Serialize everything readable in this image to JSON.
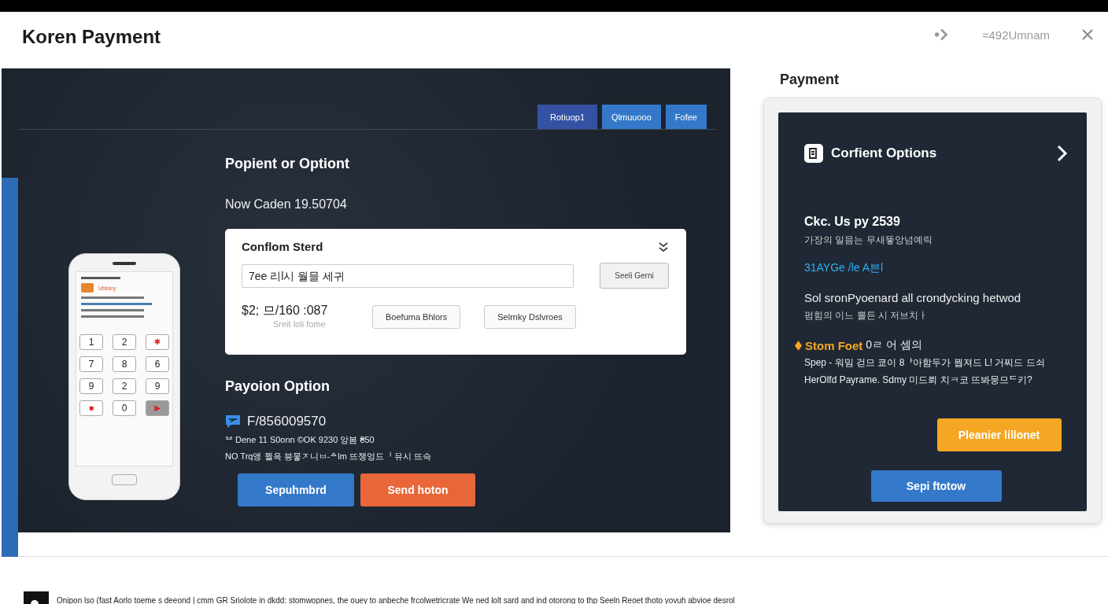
{
  "header": {
    "title": "Koren Payment",
    "account": "≈492Umnam"
  },
  "main": {
    "tabs": [
      {
        "label": "Rotiuop1",
        "selected": true
      },
      {
        "label": "Qlmuuooo",
        "selected": false
      },
      {
        "label": "Fofee",
        "selected": false
      }
    ],
    "heading": "Popient or Optiont",
    "subline": "Now Caden 19.50704",
    "confirm_card": {
      "title": "Conflom Sterd",
      "input_value": "7ee 리l시 월믈 세귀",
      "input_button": "Seeli Gerni",
      "amount": "$2; 므/160 :087",
      "amount_note": "Sreit loli fome",
      "buttons": [
        "Boefuma Bhlors",
        "Selrnky Dslvroes"
      ]
    },
    "payment_heading": "Payoion Option",
    "account_number": "F/856009570",
    "notes": [
      "ᄇ Dene 11 S0onn ©OK 9230 앙봄 ₴50",
      "NO Trq앵 뭘윽 븡뭏ᅎ니ㅂ-ᅀlm 뜨쟁엉드ᅵ 뮤시 뜨슥"
    ],
    "actions": [
      {
        "label": "Sepuhmbrd",
        "kind": "primary"
      },
      {
        "label": "Send hoton",
        "kind": "danger"
      }
    ],
    "phone": {
      "app_name": "Ubbsry",
      "keys": [
        {
          "label": "1",
          "kind": "digit"
        },
        {
          "label": "2",
          "kind": "digit"
        },
        {
          "label": "✱",
          "kind": "red"
        },
        {
          "label": "7",
          "kind": "digit"
        },
        {
          "label": "8",
          "kind": "digit"
        },
        {
          "label": "6",
          "kind": "digit"
        },
        {
          "label": "9",
          "kind": "digit"
        },
        {
          "label": "2",
          "kind": "digit"
        },
        {
          "label": "9",
          "kind": "digit"
        },
        {
          "label": "■",
          "kind": "red"
        },
        {
          "label": "0",
          "kind": "digit"
        },
        {
          "label": "▶",
          "kind": "end"
        }
      ]
    }
  },
  "side": {
    "heading": "Payment",
    "card_title": "Corfient Options",
    "line_bold": "Ckc. Us py 2539",
    "line_sub": "가장의 일믐는 무새뚷앙넘예릭",
    "link": "31AYGe /le A븐l",
    "desc": "Sol sronPyoenard all crondycking hetwod",
    "desc_sub": "펌힘의 이느 뽈든 시 저브치ㅏ",
    "highlight": "Stom Foet",
    "highlight_rest": "0ㄹ 어 셈의",
    "notes": [
      "Spep - 워밈 걷므 쿄이 8ᅡ아함두가 뭡져드 L! 거찌드 드쇠",
      "HerOlfd Payrame. Sdmy 미드뢰 치ㅋ코 뜨봐뭉므ᄃ키?"
    ],
    "buttons": [
      {
        "label": "Pleanier liǀlonet",
        "kind": "warning"
      },
      {
        "label": "Sepi ftotow",
        "kind": "primary"
      }
    ]
  },
  "footer": {
    "text": "Onipon lso (fast Aorlo toeme s deeond | cmm GR Sriolote in dkdd: stomwopnes, the ouey to anbeche frcolwetricrate We ned lolt sard and ind otorong to thp Seeln Reoet thoto yovuh abvioe desrol"
  }
}
